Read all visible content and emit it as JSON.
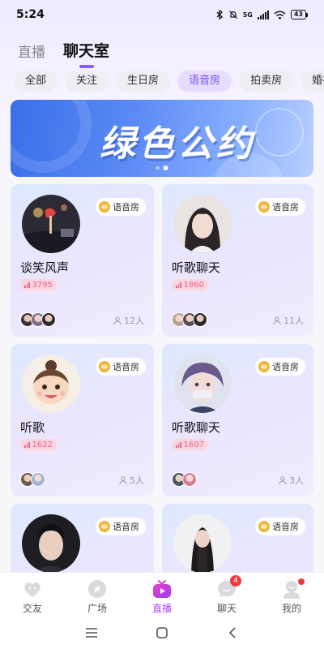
{
  "status_bar": {
    "time": "5:24",
    "network": "5G",
    "battery": "43"
  },
  "top_tabs": [
    {
      "label": "直播",
      "active": false
    },
    {
      "label": "聊天室",
      "active": true
    }
  ],
  "categories": [
    {
      "label": "全部",
      "active": false
    },
    {
      "label": "关注",
      "active": false
    },
    {
      "label": "生日房",
      "active": false
    },
    {
      "label": "语音房",
      "active": true
    },
    {
      "label": "拍卖房",
      "active": false
    },
    {
      "label": "婚礼",
      "active": false
    }
  ],
  "banner": {
    "title": "绿色公约",
    "pages": 2,
    "current_page": 2
  },
  "rooms": [
    {
      "title": "谈笑风声",
      "tag": "语音房",
      "heat": "3795",
      "online": "12人",
      "cover_icon": "night-scene-avatar",
      "members": 3
    },
    {
      "title": "听歌聊天",
      "tag": "语音房",
      "heat": "1860",
      "online": "11人",
      "cover_icon": "girl-portrait-avatar",
      "members": 3
    },
    {
      "title": "听歌",
      "tag": "语音房",
      "heat": "1622",
      "online": "5人",
      "cover_icon": "baby-avatar",
      "members": 2
    },
    {
      "title": "听歌聊天",
      "tag": "语音房",
      "heat": "1607",
      "online": "3人",
      "cover_icon": "anime-boy-avatar",
      "members": 2
    },
    {
      "title": "",
      "tag": "语音房",
      "heat": "",
      "online": "",
      "cover_icon": "man-portrait-avatar",
      "members": 0
    },
    {
      "title": "",
      "tag": "语音房",
      "heat": "",
      "online": "",
      "cover_icon": "woman-portrait-avatar",
      "members": 0
    }
  ],
  "bottom_nav": [
    {
      "label": "交友",
      "icon": "heart-face-icon",
      "active": false
    },
    {
      "label": "广场",
      "icon": "compass-icon",
      "active": false
    },
    {
      "label": "直播",
      "icon": "tv-play-icon",
      "active": true
    },
    {
      "label": "聊天",
      "icon": "chat-bubble-icon",
      "active": false,
      "badge": "4"
    },
    {
      "label": "我的",
      "icon": "profile-icon",
      "active": false,
      "dot": true
    }
  ],
  "colors": {
    "accent": "#8b5cf6",
    "active_nav": "#b24cf2",
    "heat_pink": "#f0608a",
    "banner_blue": "#3a6fe8",
    "badge_red": "#f2363e"
  }
}
